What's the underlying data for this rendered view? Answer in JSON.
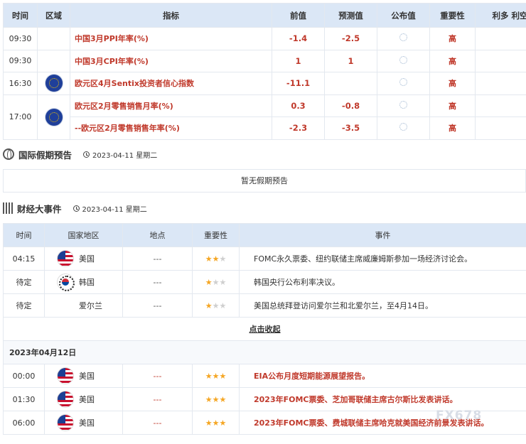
{
  "calendar": {
    "headers": [
      "时间",
      "区域",
      "指标",
      "前值",
      "预测值",
      "公布值",
      "重要性",
      "利多 利空"
    ],
    "rows": [
      {
        "time": "09:30",
        "region_icon": "",
        "indicator": "中国3月PPI年率(%)",
        "prev": "-1.4",
        "forecast": "-2.5",
        "importance": "高"
      },
      {
        "time": "09:30",
        "region_icon": "",
        "indicator": "中国3月CPI年率(%)",
        "prev": "1",
        "forecast": "1",
        "importance": "高"
      },
      {
        "time": "16:30",
        "region_icon": "eu-flag-icon",
        "indicator": "欧元区4月Sentix投资者信心指数",
        "prev": "-11.1",
        "forecast": "",
        "importance": "高"
      },
      {
        "time": "17:00",
        "region_icon": "eu-flag-icon",
        "indicator": "欧元区2月零售销售月率(%)",
        "prev": "0.3",
        "forecast": "-0.8",
        "importance": "高"
      },
      {
        "time": "",
        "region_icon": "",
        "indicator": "--欧元区2月零售销售年率(%)",
        "prev": "-2.3",
        "forecast": "-3.5",
        "importance": "高"
      }
    ]
  },
  "holiday": {
    "title": "国际假期预告",
    "date": "2023-04-11 星期二",
    "empty_text": "暂无假期预告"
  },
  "events": {
    "title": "财经大事件",
    "date": "2023-04-11 星期二",
    "headers": [
      "时间",
      "国家地区",
      "地点",
      "重要性",
      "事件"
    ],
    "rows": [
      {
        "time": "04:15",
        "flag": "us-flag-icon",
        "country": "美国",
        "place": "---",
        "stars": 2,
        "desc": "FOMC永久票委、纽约联储主席威廉姆斯参加一场经济讨论会。",
        "highlight": false
      },
      {
        "time": "待定",
        "flag": "kr-flag-icon",
        "country": "韩国",
        "place": "---",
        "stars": 1,
        "desc": "韩国央行公布利率决议。",
        "highlight": false
      },
      {
        "time": "待定",
        "flag": "",
        "country": "爱尔兰",
        "place": "---",
        "stars": 1,
        "desc": "美国总统拜登访问爱尔兰和北爱尔兰，至4月14日。",
        "highlight": false
      }
    ],
    "collapse_label": "点击收起",
    "next_date": "2023年04月12日",
    "next_rows": [
      {
        "time": "00:00",
        "flag": "us-flag-icon",
        "country": "美国",
        "place": "---",
        "stars": 3,
        "desc": "EIA公布月度短期能源展望报告。",
        "highlight": true
      },
      {
        "time": "01:30",
        "flag": "us-flag-icon",
        "country": "美国",
        "place": "---",
        "stars": 3,
        "desc": "2023年FOMC票委、芝加哥联储主席古尔斯比发表讲话。",
        "highlight": true
      },
      {
        "time": "06:00",
        "flag": "us-flag-icon",
        "country": "美国",
        "place": "---",
        "stars": 3,
        "desc": "2023年FOMC票委、费城联储主席哈克就美国经济前景发表讲话。",
        "highlight": true
      }
    ]
  },
  "watermark": "FX678"
}
